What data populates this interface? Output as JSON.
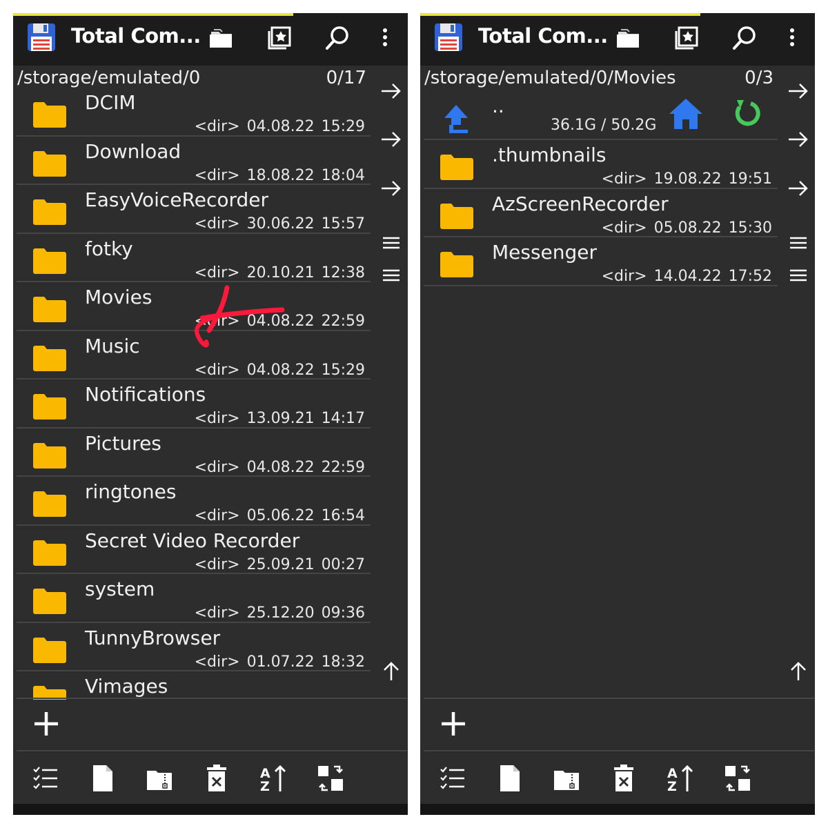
{
  "app": {
    "title": "Total Com...",
    "accent_color": "#e6e637",
    "folder_color": "#fbb800"
  },
  "left": {
    "path": "/storage/emulated/0",
    "count": "0/17",
    "items": [
      {
        "name": "DCIM",
        "type": "<dir>",
        "date": "04.08.22",
        "time": "15:29"
      },
      {
        "name": "Download",
        "type": "<dir>",
        "date": "18.08.22",
        "time": "18:04"
      },
      {
        "name": "EasyVoiceRecorder",
        "type": "<dir>",
        "date": "30.06.22",
        "time": "15:57"
      },
      {
        "name": "fotky",
        "type": "<dir>",
        "date": "20.10.21",
        "time": "12:38"
      },
      {
        "name": "Movies",
        "type": "<dir>",
        "date": "04.08.22",
        "time": "22:59"
      },
      {
        "name": "Music",
        "type": "<dir>",
        "date": "04.08.22",
        "time": "15:29"
      },
      {
        "name": "Notifications",
        "type": "<dir>",
        "date": "13.09.21",
        "time": "14:17"
      },
      {
        "name": "Pictures",
        "type": "<dir>",
        "date": "04.08.22",
        "time": "22:59"
      },
      {
        "name": "ringtones",
        "type": "<dir>",
        "date": "05.06.22",
        "time": "16:54"
      },
      {
        "name": "Secret Video Recorder",
        "type": "<dir>",
        "date": "25.09.21",
        "time": "00:27"
      },
      {
        "name": "system",
        "type": "<dir>",
        "date": "25.12.20",
        "time": "09:36"
      },
      {
        "name": "TunnyBrowser",
        "type": "<dir>",
        "date": "01.07.22",
        "time": "18:32"
      },
      {
        "name": "Vimages",
        "type": "",
        "date": "",
        "time": ""
      }
    ]
  },
  "right": {
    "path": "/storage/emulated/0/Movies",
    "count": "0/3",
    "updir": {
      "label": "..",
      "storage": "36.1G / 50.2G"
    },
    "items": [
      {
        "name": ".thumbnails",
        "type": "<dir>",
        "date": "19.08.22",
        "time": "19:51"
      },
      {
        "name": "AzScreenRecorder",
        "type": "<dir>",
        "date": "05.08.22",
        "time": "15:30"
      },
      {
        "name": "Messenger",
        "type": "<dir>",
        "date": "14.04.22",
        "time": "17:52"
      }
    ]
  },
  "icons": {
    "top": [
      "save-icon",
      "folder-icon",
      "bookmark-icon",
      "search-icon",
      "more-vert-icon"
    ],
    "side": [
      "arrow-right-icon",
      "arrow-right-icon",
      "arrow-right-icon",
      "menu-icon",
      "menu-icon",
      "arrow-up-icon"
    ],
    "bottom": [
      "select-icon",
      "new-file-icon",
      "zip-icon",
      "delete-icon",
      "sort-icon",
      "swap-icon"
    ]
  }
}
